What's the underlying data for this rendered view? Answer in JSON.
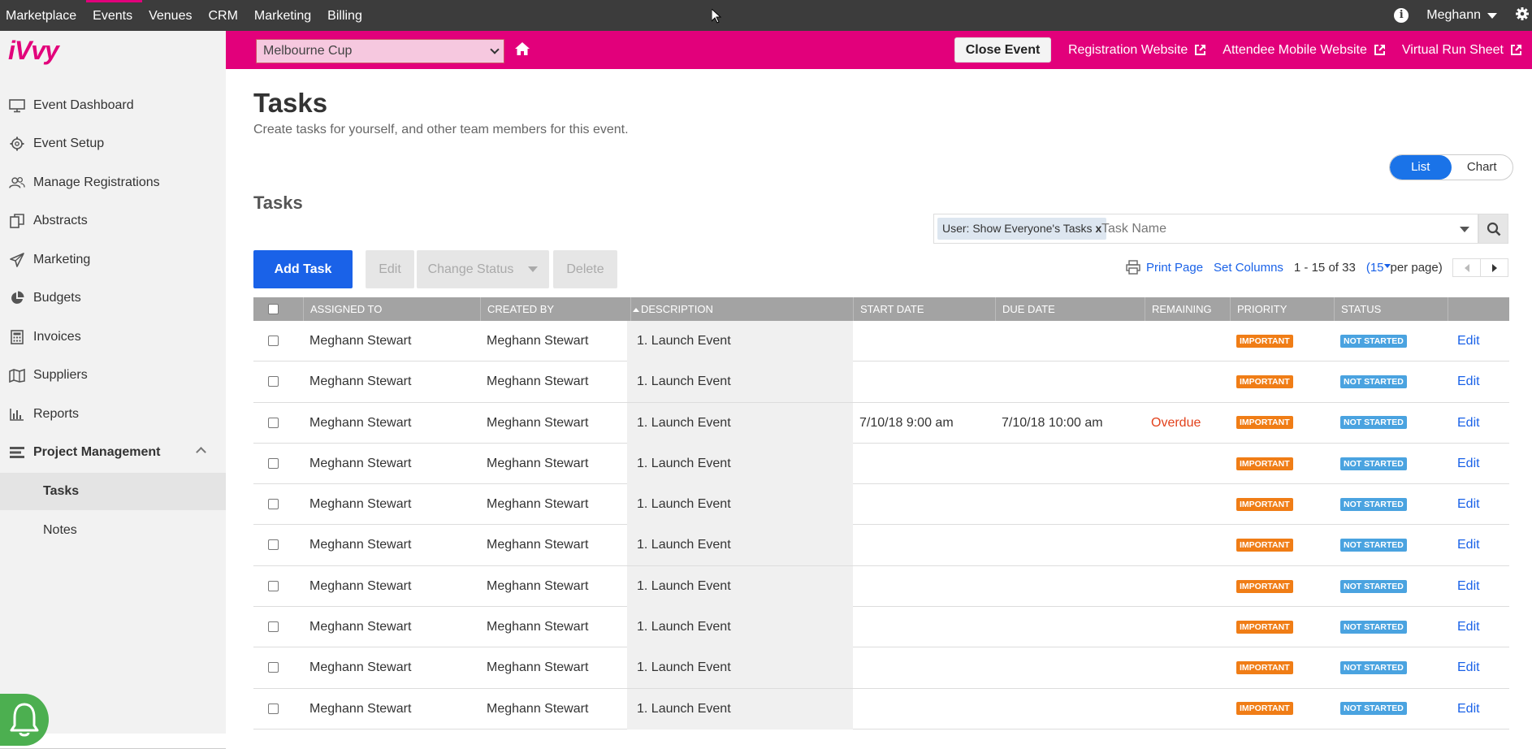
{
  "topnav": {
    "items": [
      "Marketplace",
      "Events",
      "Venues",
      "CRM",
      "Marketing",
      "Billing"
    ],
    "active": "Events",
    "user": "Meghann"
  },
  "eventbar": {
    "event_name": "Melbourne Cup",
    "close_event": "Close Event",
    "links": [
      "Registration Website",
      "Attendee Mobile Website",
      "Virtual Run Sheet"
    ],
    "color": "#e2007b"
  },
  "sidebar": {
    "logo": "iVvy",
    "items": [
      {
        "label": "Event Dashboard",
        "icon": "monitor-icon"
      },
      {
        "label": "Event Setup",
        "icon": "gear-icon"
      },
      {
        "label": "Manage Registrations",
        "icon": "users-icon"
      },
      {
        "label": "Abstracts",
        "icon": "copy-icon"
      },
      {
        "label": "Marketing",
        "icon": "paper-plane-icon"
      },
      {
        "label": "Budgets",
        "icon": "pie-chart-icon"
      },
      {
        "label": "Invoices",
        "icon": "calculator-icon"
      },
      {
        "label": "Suppliers",
        "icon": "map-icon"
      },
      {
        "label": "Reports",
        "icon": "bar-chart-icon"
      },
      {
        "label": "Project Management",
        "icon": "tasks-icon"
      }
    ],
    "subitems": [
      "Tasks",
      "Notes"
    ],
    "active_subitem": "Tasks"
  },
  "page": {
    "title": "Tasks",
    "subtitle": "Create tasks for yourself, and other team members for this event.",
    "view_toggle": [
      "List",
      "Chart"
    ],
    "view_active": "List",
    "section_title": "Tasks"
  },
  "filter": {
    "chip": "User: Show Everyone's Tasks",
    "chip_remove": "x",
    "placeholder": "Task Name"
  },
  "toolbar": {
    "add_task": "Add Task",
    "edit": "Edit",
    "change_status": "Change Status",
    "delete": "Delete"
  },
  "pager": {
    "print": "Print Page",
    "set_columns": "Set Columns",
    "range": "1 - 15 of 33",
    "per_page_open": "(",
    "per_page_value": "15",
    "per_page_close": " per page)"
  },
  "table": {
    "headers": [
      "ASSIGNED TO",
      "CREATED BY",
      "DESCRIPTION",
      "START DATE",
      "DUE DATE",
      "REMAINING",
      "PRIORITY",
      "STATUS"
    ],
    "rows": [
      {
        "assigned": "Meghann Stewart",
        "created": "Meghann Stewart",
        "desc": "1. Launch Event",
        "start": "",
        "due": "",
        "remaining": "",
        "priority": "IMPORTANT",
        "status": "NOT STARTED",
        "action": "Edit"
      },
      {
        "assigned": "Meghann Stewart",
        "created": "Meghann Stewart",
        "desc": "1. Launch Event",
        "start": "",
        "due": "",
        "remaining": "",
        "priority": "IMPORTANT",
        "status": "NOT STARTED",
        "action": "Edit"
      },
      {
        "assigned": "Meghann Stewart",
        "created": "Meghann Stewart",
        "desc": "1. Launch Event",
        "start": "7/10/18 9:00 am",
        "due": "7/10/18 10:00 am",
        "remaining": "Overdue",
        "priority": "IMPORTANT",
        "status": "NOT STARTED",
        "action": "Edit"
      },
      {
        "assigned": "Meghann Stewart",
        "created": "Meghann Stewart",
        "desc": "1. Launch Event",
        "start": "",
        "due": "",
        "remaining": "",
        "priority": "IMPORTANT",
        "status": "NOT STARTED",
        "action": "Edit"
      },
      {
        "assigned": "Meghann Stewart",
        "created": "Meghann Stewart",
        "desc": "1. Launch Event",
        "start": "",
        "due": "",
        "remaining": "",
        "priority": "IMPORTANT",
        "status": "NOT STARTED",
        "action": "Edit"
      },
      {
        "assigned": "Meghann Stewart",
        "created": "Meghann Stewart",
        "desc": "1. Launch Event",
        "start": "",
        "due": "",
        "remaining": "",
        "priority": "IMPORTANT",
        "status": "NOT STARTED",
        "action": "Edit"
      },
      {
        "assigned": "Meghann Stewart",
        "created": "Meghann Stewart",
        "desc": "1. Launch Event",
        "start": "",
        "due": "",
        "remaining": "",
        "priority": "IMPORTANT",
        "status": "NOT STARTED",
        "action": "Edit"
      },
      {
        "assigned": "Meghann Stewart",
        "created": "Meghann Stewart",
        "desc": "1. Launch Event",
        "start": "",
        "due": "",
        "remaining": "",
        "priority": "IMPORTANT",
        "status": "NOT STARTED",
        "action": "Edit"
      },
      {
        "assigned": "Meghann Stewart",
        "created": "Meghann Stewart",
        "desc": "1. Launch Event",
        "start": "",
        "due": "",
        "remaining": "",
        "priority": "IMPORTANT",
        "status": "NOT STARTED",
        "action": "Edit"
      },
      {
        "assigned": "Meghann Stewart",
        "created": "Meghann Stewart",
        "desc": "1. Launch Event",
        "start": "",
        "due": "",
        "remaining": "",
        "priority": "IMPORTANT",
        "status": "NOT STARTED",
        "action": "Edit"
      }
    ]
  },
  "colors": {
    "accent": "#1a62e8",
    "brand": "#e2007b",
    "important": "#f07d16",
    "not_started": "#4aa3e0",
    "overdue": "#e2411b"
  }
}
